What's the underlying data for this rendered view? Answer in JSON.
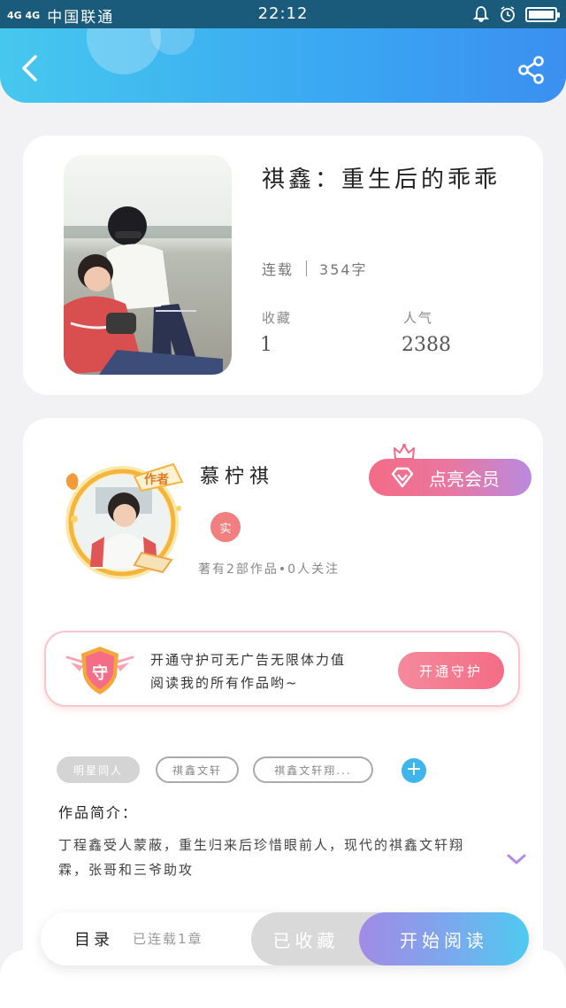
{
  "status_bar": {
    "signal": "4G 4G",
    "carrier": "中国联通",
    "time": "22:12"
  },
  "header": {
    "back_icon": "chevron-left-icon",
    "share_icon": "share-icon",
    "gradient_colors": [
      "#46c8ee",
      "#3b8ff0"
    ]
  },
  "book": {
    "title": "祺鑫：重生后的乖乖",
    "status": "连载",
    "word_count": "354字",
    "collect_label": "收藏",
    "collect_value": "1",
    "popularity_label": "人气",
    "popularity_value": "2388"
  },
  "author": {
    "avatar_badge": "作者",
    "name": "慕柠祺",
    "verified_badge": "实",
    "meta": "著有2部作品•0人关注",
    "vip_button": "点亮会员"
  },
  "guardian": {
    "shield_glyph": "守",
    "text_line1": "开通守护可无广告无限体力值",
    "text_line2": "阅读我的所有作品哟~",
    "button": "开通守护"
  },
  "tags": [
    {
      "label": "明星同人",
      "style": "filled"
    },
    {
      "label": "祺鑫文轩",
      "style": "outline"
    },
    {
      "label": "祺鑫文轩翔...",
      "style": "outline"
    }
  ],
  "intro": {
    "title": "作品简介：",
    "text": "丁程鑫受人蒙蔽，重生归来后珍惜眼前人，现代的祺鑫文轩翔霖，张哥和三爷助攻"
  },
  "bottom_bar": {
    "toc_label": "目录",
    "toc_status": "已连载1章",
    "collected_button": "已收藏",
    "read_button": "开始阅读",
    "accent": "#4fcaef"
  }
}
